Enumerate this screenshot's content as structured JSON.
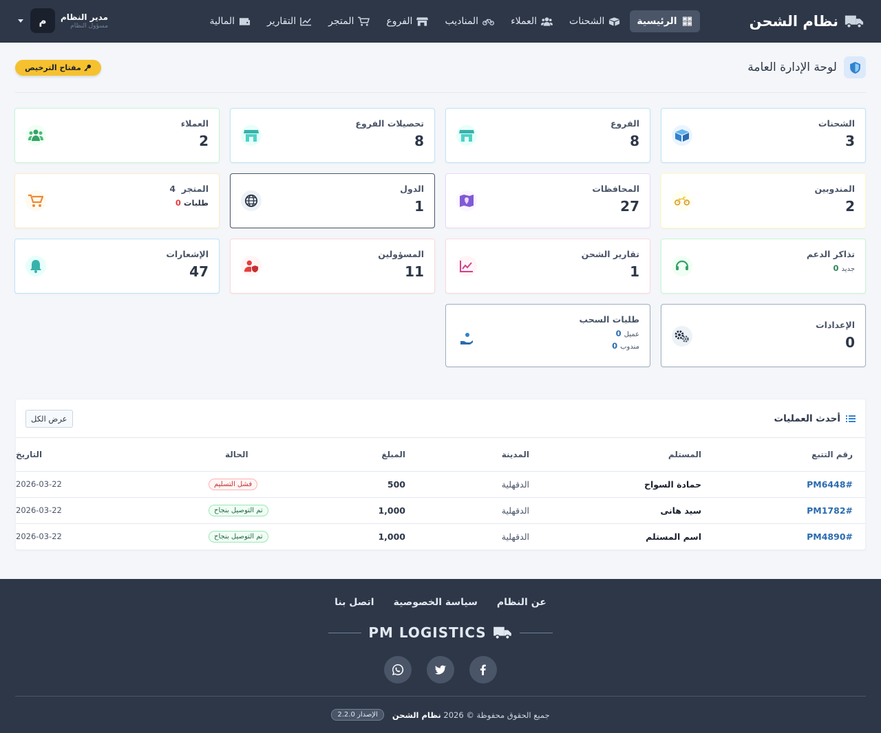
{
  "app": {
    "brand": "نظام الشحن",
    "user_name": "مدير النظام",
    "user_role": "مسؤول النظام",
    "avatar_letter": "م"
  },
  "nav": [
    {
      "label": "الرئيسية",
      "icon": "dashboard-icon",
      "active": true
    },
    {
      "label": "الشحنات",
      "icon": "boxes-icon"
    },
    {
      "label": "العملاء",
      "icon": "users-icon"
    },
    {
      "label": "المناديب",
      "icon": "bicycle-icon"
    },
    {
      "label": "الفروع",
      "icon": "store-icon"
    },
    {
      "label": "المتجر",
      "icon": "cart-icon"
    },
    {
      "label": "التقارير",
      "icon": "chart-icon"
    },
    {
      "label": "المالية",
      "icon": "wallet-icon"
    }
  ],
  "header": {
    "title": "لوحة الإدارة العامة",
    "license_button": "مفتاح الترخيص"
  },
  "cards": {
    "shipments": {
      "label": "الشحنات",
      "value": "3"
    },
    "branches": {
      "label": "الفروع",
      "value": "8"
    },
    "branch_collections": {
      "label": "تحصيلات الفروع",
      "value": "8"
    },
    "customers": {
      "label": "العملاء",
      "value": "2"
    },
    "couriers": {
      "label": "المندوبين",
      "value": "2"
    },
    "governorates": {
      "label": "المحافظات",
      "value": "27"
    },
    "countries": {
      "label": "الدول",
      "value": "1"
    },
    "store": {
      "label": "المتجر",
      "count": "4",
      "orders_label": "طلبات",
      "orders_value": "0"
    },
    "support": {
      "label": "تذاكر الدعم",
      "new_label": "جديد",
      "new_value": "0"
    },
    "shipping_reports": {
      "label": "تقارير الشحن",
      "value": "1"
    },
    "officials": {
      "label": "المسؤولين",
      "value": "11"
    },
    "notifications": {
      "label": "الإشعارات",
      "value": "47"
    },
    "settings": {
      "label": "الإعدادات",
      "value": "0"
    },
    "withdrawals": {
      "label": "طلبات السحب",
      "customer_label": "عميل",
      "customer_value": "0",
      "courier_label": "مندوب",
      "courier_value": "0"
    }
  },
  "operations": {
    "title": "أحدث العمليات",
    "view_all": "عرض الكل",
    "columns": [
      "رقم التتبع",
      "المستلم",
      "المدينة",
      "المبلغ",
      "الحالة",
      "التاريخ"
    ],
    "rows": [
      {
        "tracking": "PM6448#",
        "receiver": "حمادة السواح",
        "city": "الدقهلية",
        "amount": "500",
        "status": "فشل التسليم",
        "status_type": "fail",
        "date": "2026-03-22"
      },
      {
        "tracking": "PM1782#",
        "receiver": "سيد هانى",
        "city": "الدقهلية",
        "amount": "1,000",
        "status": "تم التوصيل بنجاح",
        "status_type": "ok",
        "date": "2026-03-22"
      },
      {
        "tracking": "PM4890#",
        "receiver": "اسم المستلم",
        "city": "الدقهلية",
        "amount": "1,000",
        "status": "تم التوصيل بنجاح",
        "status_type": "ok",
        "date": "2026-03-22"
      }
    ]
  },
  "footer": {
    "links": [
      "عن النظام",
      "سياسة الخصوصية",
      "اتصل بنا"
    ],
    "logo_text": "PM LOGISTICS",
    "socials": [
      "facebook-icon",
      "twitter-icon",
      "whatsapp-icon"
    ],
    "copyright_prefix": "جميع الحقوق محفوظة © 2026",
    "copyright_brand": "نظام الشحن",
    "version": "الإصدار 2.2.0"
  },
  "colors": {
    "navbar": "#2d3748",
    "accent_blue": "#2b6cb0",
    "license_yellow": "#f6c12f",
    "fail_red": "#c53030",
    "success_green": "#276749"
  }
}
